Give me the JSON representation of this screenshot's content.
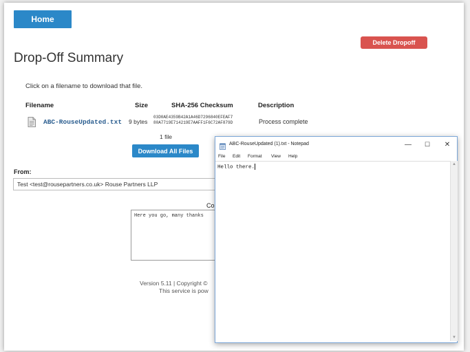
{
  "nav": {
    "home_label": "Home"
  },
  "header": {
    "delete_label": "Delete Dropoff",
    "title": "Drop-Off Summary"
  },
  "instruction": "Click on a filename to download that file.",
  "table": {
    "headers": [
      "Filename",
      "Size",
      "SHA-256 Checksum",
      "Description"
    ],
    "rows": [
      {
        "filename": "ABC-RouseUpdated.txt",
        "size": "9 bytes",
        "checksum_line1": "03D0AE4359B42A1A46D7296840EFEAF7",
        "checksum_line2": "80A7719E714219E7AAFF1F6C72AF879D",
        "description": "Process complete"
      }
    ]
  },
  "file_count": "1 file",
  "download_all_label": "Download All Files",
  "from": {
    "label": "From:",
    "value": "Test  <test@rousepartners.co.uk>  Rouse Partners LLP"
  },
  "comments": {
    "label_partial": "Co",
    "text_partial": "Here you go, many thanks"
  },
  "footer": {
    "line1_partial": "Version 5.11 | Copyright ©",
    "line2_partial": "This service is pow"
  },
  "notepad": {
    "title": "ABC-RouseUpdated (1).txt - Notepad",
    "menu": [
      "File",
      "Edit",
      "Format",
      "View",
      "Help"
    ],
    "content": "Hello there.",
    "minimize": "—",
    "maximize": "☐",
    "close": "✕"
  },
  "colors": {
    "primary": "#2b88c8",
    "danger": "#d9534f",
    "link": "#2a5d8f"
  }
}
